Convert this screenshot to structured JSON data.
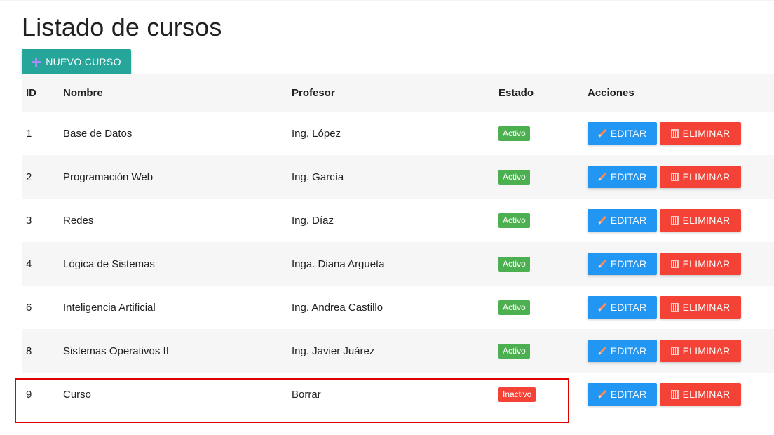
{
  "page": {
    "title": "Listado de cursos",
    "new_button_label": "NUEVO CURSO"
  },
  "table": {
    "headers": {
      "id": "ID",
      "name": "Nombre",
      "professor": "Profesor",
      "status": "Estado",
      "actions": "Acciones"
    },
    "rows": [
      {
        "id": "1",
        "name": "Base de Datos",
        "professor": "Ing. López",
        "status": "Activo",
        "status_key": "activo"
      },
      {
        "id": "2",
        "name": "Programación Web",
        "professor": "Ing. García",
        "status": "Activo",
        "status_key": "activo"
      },
      {
        "id": "3",
        "name": "Redes",
        "professor": "Ing. Díaz",
        "status": "Activo",
        "status_key": "activo"
      },
      {
        "id": "4",
        "name": "Lógica de Sistemas",
        "professor": "Inga. Diana Argueta",
        "status": "Activo",
        "status_key": "activo"
      },
      {
        "id": "6",
        "name": "Inteligencia Artificial",
        "professor": "Ing. Andrea Castillo",
        "status": "Activo",
        "status_key": "activo"
      },
      {
        "id": "8",
        "name": "Sistemas Operativos II",
        "professor": "Ing. Javier Juárez",
        "status": "Activo",
        "status_key": "activo"
      },
      {
        "id": "9",
        "name": "Curso",
        "professor": "Borrar",
        "status": "Inactivo",
        "status_key": "inactivo"
      }
    ],
    "edit_label": "EDITAR",
    "delete_label": "ELIMINAR"
  },
  "icons": {
    "new": "plus-icon",
    "edit": "pencil-icon",
    "delete": "trash-icon"
  },
  "colors": {
    "primary_teal": "#26a69a",
    "edit_blue": "#2196f3",
    "delete_red": "#f44336",
    "active_green": "#4caf50",
    "highlight_red": "#e00000",
    "stripe": "#f6f6f6"
  }
}
